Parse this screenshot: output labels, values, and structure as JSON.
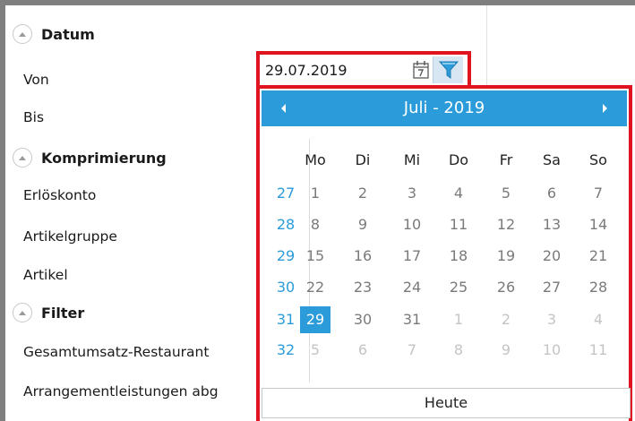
{
  "sections": {
    "datum": "Datum",
    "komprimierung": "Komprimierung",
    "filter": "Filter"
  },
  "fields": {
    "von": "Von",
    "bis": "Bis",
    "erloeskonto": "Erlöskonto",
    "artikelgruppe": "Artikelgruppe",
    "artikel": "Artikel",
    "gesamtumsatz": "Gesamtumsatz-Restaurant",
    "arrangement": "Arrangementleistungen abg"
  },
  "date_input": {
    "value": "29.07.2019"
  },
  "calendar": {
    "title": "Juli - 2019",
    "today_label": "Heute",
    "day_names": [
      "Mo",
      "Di",
      "Mi",
      "Do",
      "Fr",
      "Sa",
      "So"
    ],
    "weeks": [
      {
        "wk": "27",
        "days": [
          "1",
          "2",
          "3",
          "4",
          "5",
          "6",
          "7"
        ]
      },
      {
        "wk": "28",
        "days": [
          "8",
          "9",
          "10",
          "11",
          "12",
          "13",
          "14"
        ]
      },
      {
        "wk": "29",
        "days": [
          "15",
          "16",
          "17",
          "18",
          "19",
          "20",
          "21"
        ]
      },
      {
        "wk": "30",
        "days": [
          "22",
          "23",
          "24",
          "25",
          "26",
          "27",
          "28"
        ]
      },
      {
        "wk": "31",
        "days": [
          "29",
          "30",
          "31",
          "1",
          "2",
          "3",
          "4"
        ]
      },
      {
        "wk": "32",
        "days": [
          "5",
          "6",
          "7",
          "8",
          "9",
          "10",
          "11"
        ]
      }
    ]
  },
  "colors": {
    "accent": "#2b9bd9",
    "highlight_border": "#e0141e"
  },
  "icons": {
    "collapse": "chevron-up-icon",
    "calendar": "calendar-icon",
    "filter": "filter-icon"
  }
}
